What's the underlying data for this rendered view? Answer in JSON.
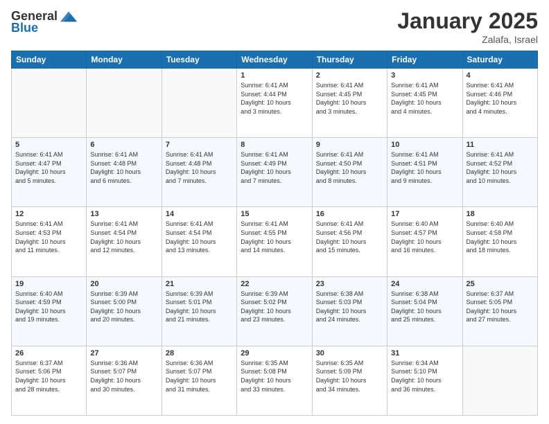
{
  "header": {
    "logo_general": "General",
    "logo_blue": "Blue",
    "month_title": "January 2025",
    "location": "Zalafa, Israel"
  },
  "days_of_week": [
    "Sunday",
    "Monday",
    "Tuesday",
    "Wednesday",
    "Thursday",
    "Friday",
    "Saturday"
  ],
  "weeks": [
    [
      {
        "day": "",
        "info": ""
      },
      {
        "day": "",
        "info": ""
      },
      {
        "day": "",
        "info": ""
      },
      {
        "day": "1",
        "info": "Sunrise: 6:41 AM\nSunset: 4:44 PM\nDaylight: 10 hours\nand 3 minutes."
      },
      {
        "day": "2",
        "info": "Sunrise: 6:41 AM\nSunset: 4:45 PM\nDaylight: 10 hours\nand 3 minutes."
      },
      {
        "day": "3",
        "info": "Sunrise: 6:41 AM\nSunset: 4:45 PM\nDaylight: 10 hours\nand 4 minutes."
      },
      {
        "day": "4",
        "info": "Sunrise: 6:41 AM\nSunset: 4:46 PM\nDaylight: 10 hours\nand 4 minutes."
      }
    ],
    [
      {
        "day": "5",
        "info": "Sunrise: 6:41 AM\nSunset: 4:47 PM\nDaylight: 10 hours\nand 5 minutes."
      },
      {
        "day": "6",
        "info": "Sunrise: 6:41 AM\nSunset: 4:48 PM\nDaylight: 10 hours\nand 6 minutes."
      },
      {
        "day": "7",
        "info": "Sunrise: 6:41 AM\nSunset: 4:48 PM\nDaylight: 10 hours\nand 7 minutes."
      },
      {
        "day": "8",
        "info": "Sunrise: 6:41 AM\nSunset: 4:49 PM\nDaylight: 10 hours\nand 7 minutes."
      },
      {
        "day": "9",
        "info": "Sunrise: 6:41 AM\nSunset: 4:50 PM\nDaylight: 10 hours\nand 8 minutes."
      },
      {
        "day": "10",
        "info": "Sunrise: 6:41 AM\nSunset: 4:51 PM\nDaylight: 10 hours\nand 9 minutes."
      },
      {
        "day": "11",
        "info": "Sunrise: 6:41 AM\nSunset: 4:52 PM\nDaylight: 10 hours\nand 10 minutes."
      }
    ],
    [
      {
        "day": "12",
        "info": "Sunrise: 6:41 AM\nSunset: 4:53 PM\nDaylight: 10 hours\nand 11 minutes."
      },
      {
        "day": "13",
        "info": "Sunrise: 6:41 AM\nSunset: 4:54 PM\nDaylight: 10 hours\nand 12 minutes."
      },
      {
        "day": "14",
        "info": "Sunrise: 6:41 AM\nSunset: 4:54 PM\nDaylight: 10 hours\nand 13 minutes."
      },
      {
        "day": "15",
        "info": "Sunrise: 6:41 AM\nSunset: 4:55 PM\nDaylight: 10 hours\nand 14 minutes."
      },
      {
        "day": "16",
        "info": "Sunrise: 6:41 AM\nSunset: 4:56 PM\nDaylight: 10 hours\nand 15 minutes."
      },
      {
        "day": "17",
        "info": "Sunrise: 6:40 AM\nSunset: 4:57 PM\nDaylight: 10 hours\nand 16 minutes."
      },
      {
        "day": "18",
        "info": "Sunrise: 6:40 AM\nSunset: 4:58 PM\nDaylight: 10 hours\nand 18 minutes."
      }
    ],
    [
      {
        "day": "19",
        "info": "Sunrise: 6:40 AM\nSunset: 4:59 PM\nDaylight: 10 hours\nand 19 minutes."
      },
      {
        "day": "20",
        "info": "Sunrise: 6:39 AM\nSunset: 5:00 PM\nDaylight: 10 hours\nand 20 minutes."
      },
      {
        "day": "21",
        "info": "Sunrise: 6:39 AM\nSunset: 5:01 PM\nDaylight: 10 hours\nand 21 minutes."
      },
      {
        "day": "22",
        "info": "Sunrise: 6:39 AM\nSunset: 5:02 PM\nDaylight: 10 hours\nand 23 minutes."
      },
      {
        "day": "23",
        "info": "Sunrise: 6:38 AM\nSunset: 5:03 PM\nDaylight: 10 hours\nand 24 minutes."
      },
      {
        "day": "24",
        "info": "Sunrise: 6:38 AM\nSunset: 5:04 PM\nDaylight: 10 hours\nand 25 minutes."
      },
      {
        "day": "25",
        "info": "Sunrise: 6:37 AM\nSunset: 5:05 PM\nDaylight: 10 hours\nand 27 minutes."
      }
    ],
    [
      {
        "day": "26",
        "info": "Sunrise: 6:37 AM\nSunset: 5:06 PM\nDaylight: 10 hours\nand 28 minutes."
      },
      {
        "day": "27",
        "info": "Sunrise: 6:36 AM\nSunset: 5:07 PM\nDaylight: 10 hours\nand 30 minutes."
      },
      {
        "day": "28",
        "info": "Sunrise: 6:36 AM\nSunset: 5:07 PM\nDaylight: 10 hours\nand 31 minutes."
      },
      {
        "day": "29",
        "info": "Sunrise: 6:35 AM\nSunset: 5:08 PM\nDaylight: 10 hours\nand 33 minutes."
      },
      {
        "day": "30",
        "info": "Sunrise: 6:35 AM\nSunset: 5:09 PM\nDaylight: 10 hours\nand 34 minutes."
      },
      {
        "day": "31",
        "info": "Sunrise: 6:34 AM\nSunset: 5:10 PM\nDaylight: 10 hours\nand 36 minutes."
      },
      {
        "day": "",
        "info": ""
      }
    ]
  ]
}
